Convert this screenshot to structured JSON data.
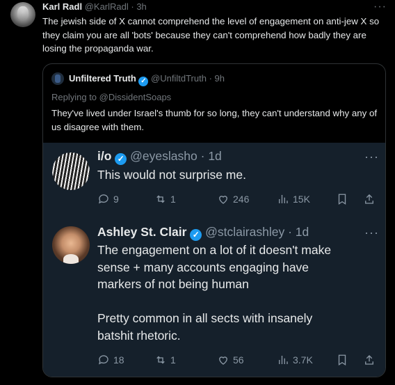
{
  "main_tweet": {
    "name": "Karl Radl",
    "handle": "@KarlRadl",
    "time": "· 3h",
    "more": "···",
    "text": "The jewish side of X cannot comprehend the level of engagement on anti-jew X so they claim you are all 'bots' because they can't comprehend how badly they are losing the propaganda war."
  },
  "quoted_tweet": {
    "name": "Unfiltered Truth",
    "handle": "@UnfiltdTruth",
    "time": "· 9h",
    "replying_to": "Replying to @DissidentSoaps",
    "text": "They've lived under Israel's thumb for so long, they can't understand why any of us disagree with them."
  },
  "replies": [
    {
      "name": "i/o",
      "handle": "@eyeslasho",
      "time": "· 1d",
      "more": "···",
      "text": "This would not surprise me.",
      "replies": "9",
      "reposts": "1",
      "likes": "246",
      "views": "15K"
    },
    {
      "name": "Ashley St. Clair",
      "handle": "@stclairashley",
      "time": "· 1d",
      "more": "···",
      "text_lines": [
        "The engagement on a lot of it doesn't make",
        "sense + many accounts engaging have",
        "markers of not being human",
        "",
        "Pretty common in all sects with insanely",
        "batshit rhetoric."
      ],
      "replies": "18",
      "reposts": "1",
      "likes": "56",
      "views": "3.7K"
    }
  ],
  "icons": {
    "verified": "verified-badge-icon",
    "reply": "reply-icon",
    "repost": "repost-icon",
    "like": "heart-icon",
    "views": "views-chart-icon",
    "bookmark": "bookmark-icon",
    "share": "share-icon"
  },
  "colors": {
    "verified": "#1d9bf0",
    "reply_bg": "#15202b",
    "muted": "#71767b"
  }
}
